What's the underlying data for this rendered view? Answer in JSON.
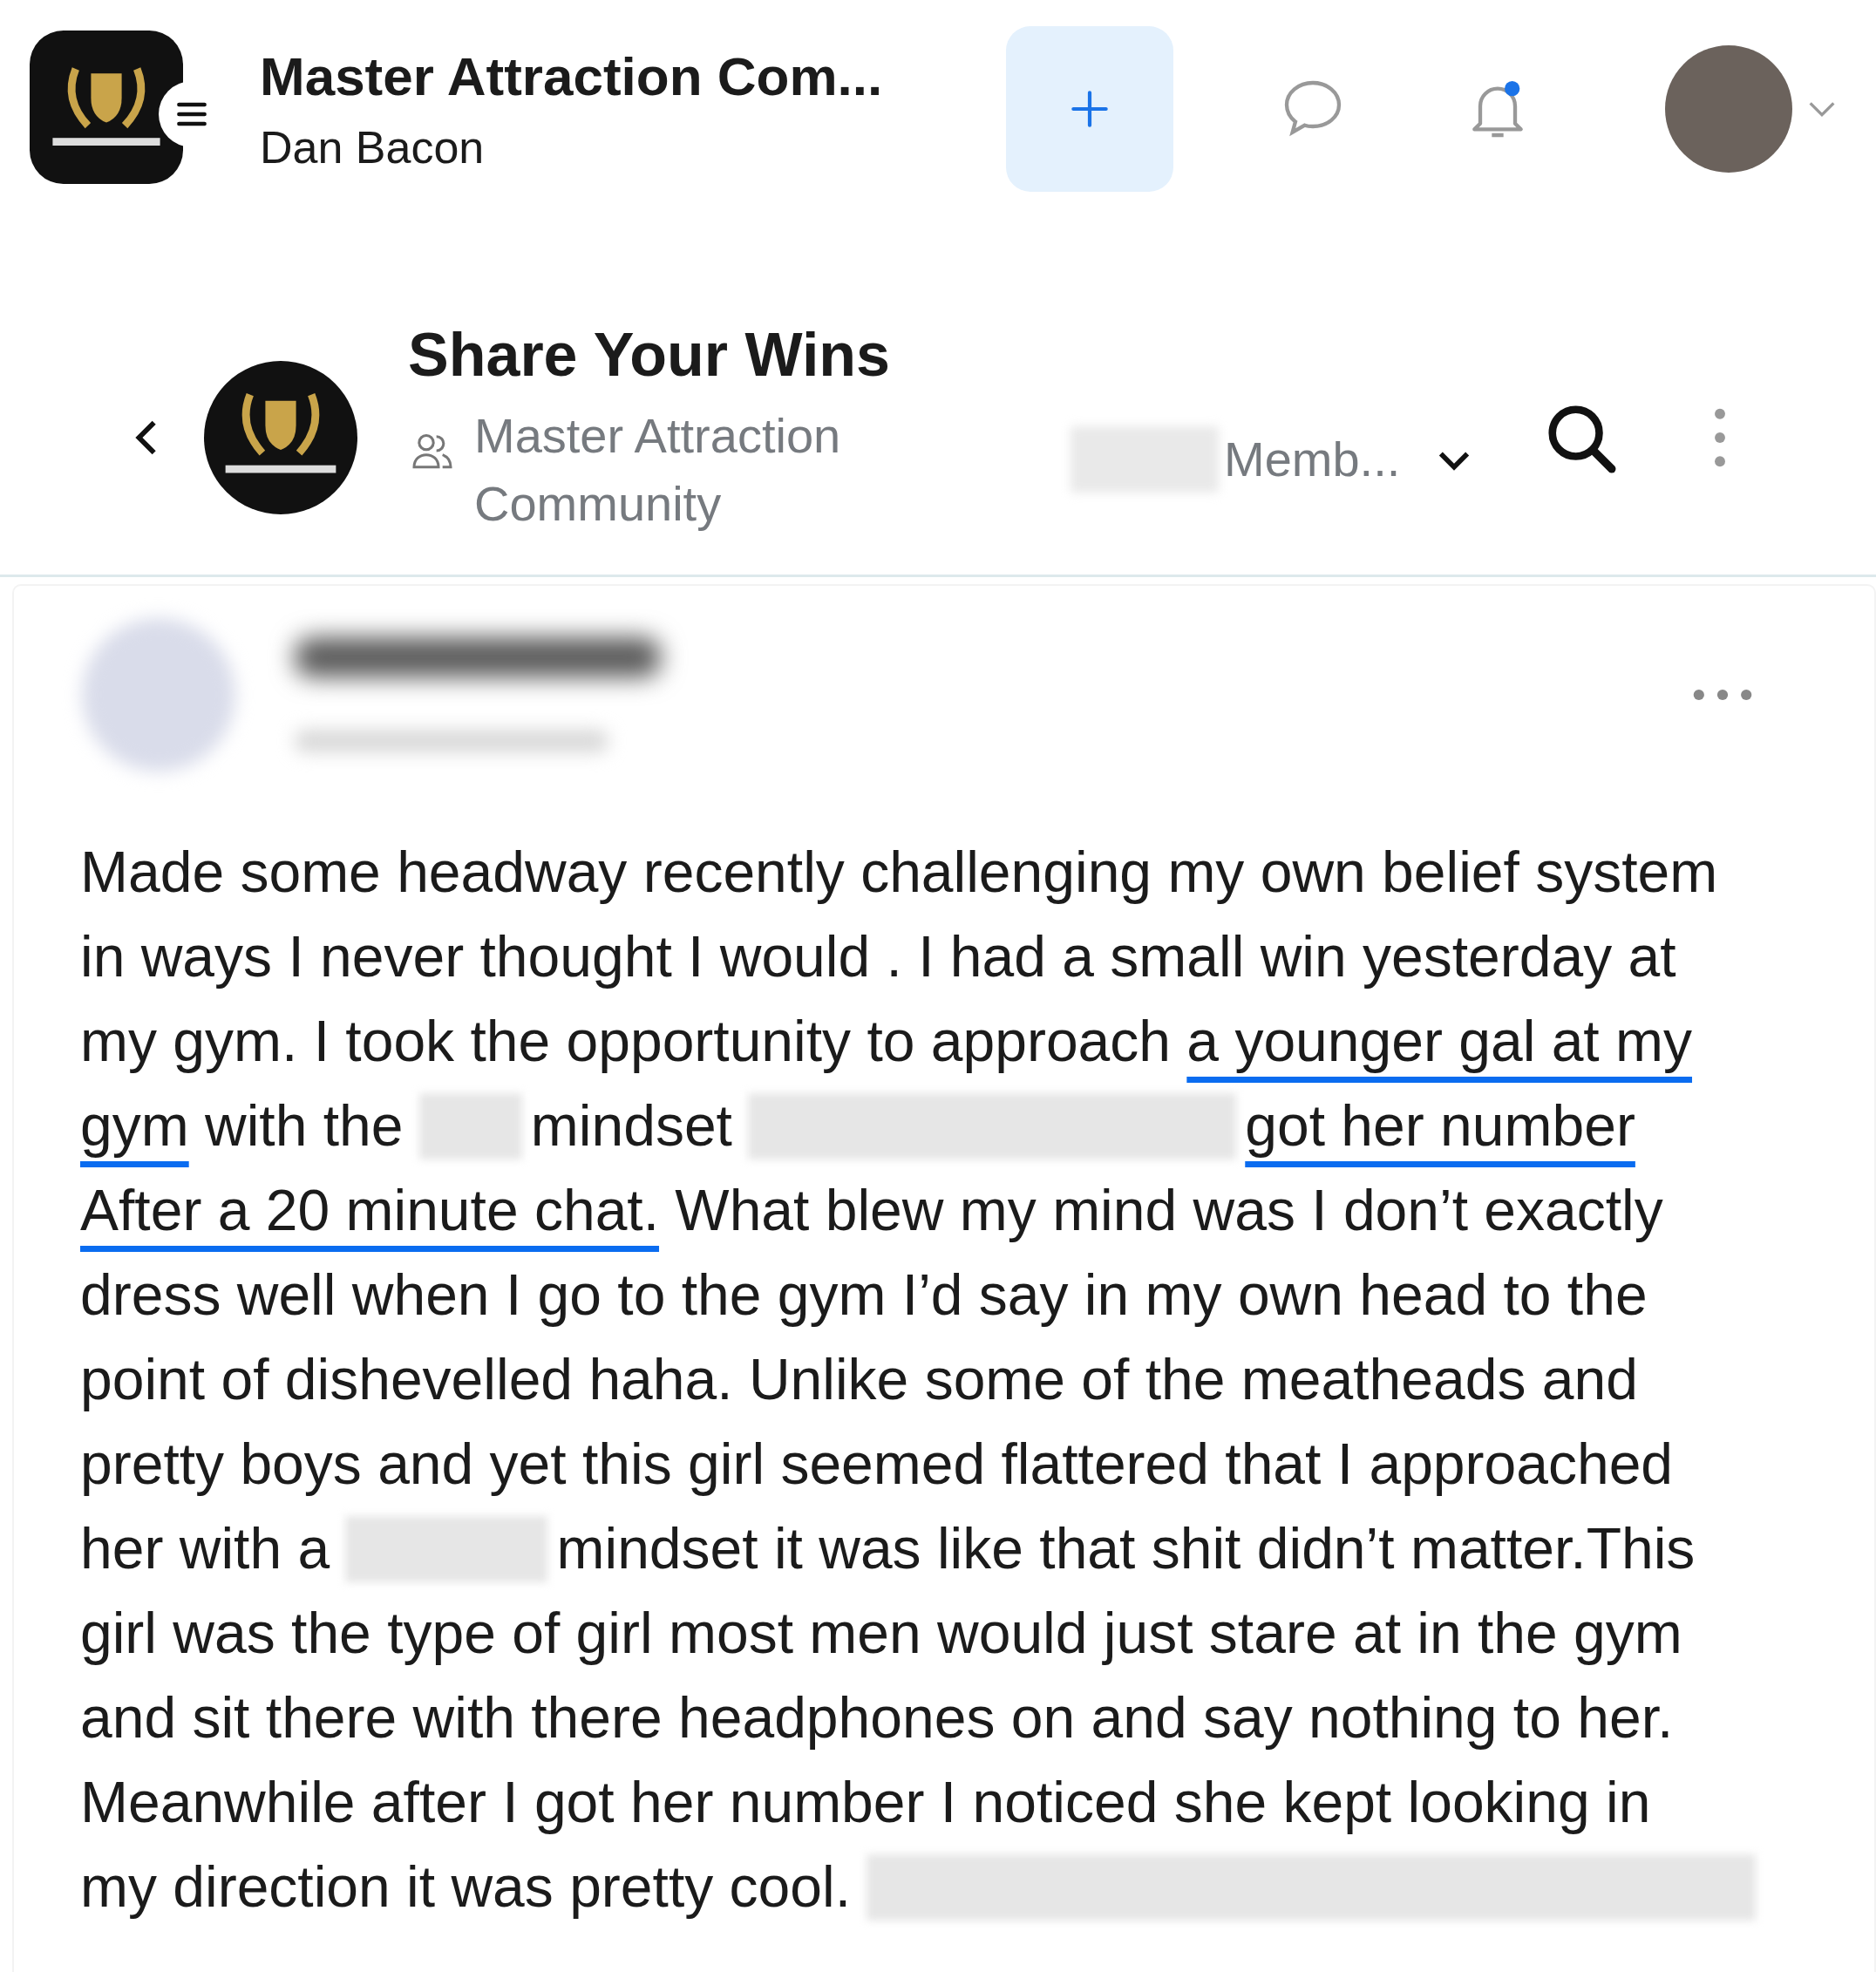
{
  "top_bar": {
    "title": "Master Attraction Com...",
    "subtitle": "Dan Bacon",
    "notification_dot": true
  },
  "channel_header": {
    "title": "Share Your Wins",
    "community": "Master Attraction Community",
    "members": "Memb..."
  },
  "post": {
    "body_lines": [
      [
        {
          "kind": "text",
          "text": "Made some headway recently challenging my own belief system"
        }
      ],
      [
        {
          "kind": "text",
          "text": "in ways I never thought I would . I had a small win yesterday at"
        }
      ],
      [
        {
          "kind": "text",
          "text": "my gym. I took the opportunity to approach "
        },
        {
          "kind": "underlined",
          "text": "a younger gal at my"
        }
      ],
      [
        {
          "kind": "underlined",
          "text": "gym"
        },
        {
          "kind": "text",
          "text": " with the "
        },
        {
          "kind": "blur_short"
        },
        {
          "kind": "text",
          "text": "mindset "
        },
        {
          "kind": "blur_long"
        },
        {
          "kind": "underlined",
          "text": "got her number"
        }
      ],
      [
        {
          "kind": "underlined",
          "text": "After a 20 minute chat."
        },
        {
          "kind": "text",
          "text": " What blew my mind was I don’t exactly"
        }
      ],
      [
        {
          "kind": "text",
          "text": "dress well when I go to the gym I’d say in my own head to the"
        }
      ],
      [
        {
          "kind": "text",
          "text": "point of dishevelled haha. Unlike some of the meatheads and"
        }
      ],
      [
        {
          "kind": "text",
          "text": "pretty boys and yet this girl seemed flattered that I approached"
        }
      ],
      [
        {
          "kind": "text",
          "text": "her with a "
        },
        {
          "kind": "blur_mid"
        },
        {
          "kind": "text",
          "text": "mindset it was like that shit didn’t matter.This"
        }
      ],
      [
        {
          "kind": "text",
          "text": "girl was the type of girl most men would just stare at in the gym"
        }
      ],
      [
        {
          "kind": "text",
          "text": "and sit there with there headphones on and say nothing to her."
        }
      ],
      [
        {
          "kind": "text",
          "text": "Meanwhile after I got her number I noticed she kept looking in"
        }
      ],
      [
        {
          "kind": "text",
          "text": "my direction it was pretty cool. "
        },
        {
          "kind": "blur_rest"
        }
      ]
    ]
  }
}
